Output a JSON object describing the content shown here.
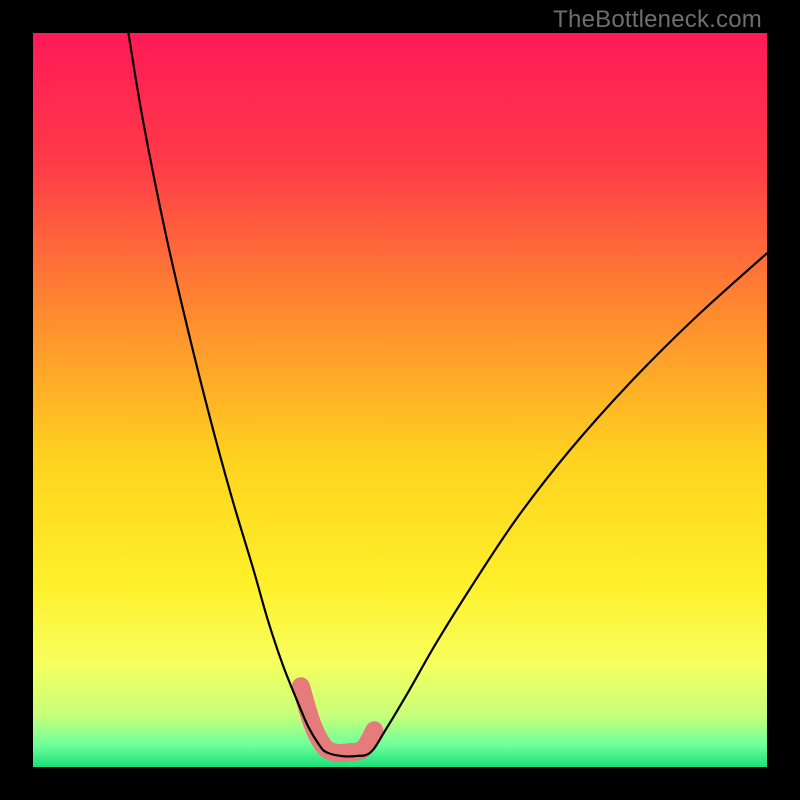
{
  "watermark": "TheBottleneck.com",
  "chart_data": {
    "type": "line",
    "title": "",
    "xlabel": "",
    "ylabel": "",
    "x_range": [
      0,
      100
    ],
    "y_range": [
      0,
      100
    ],
    "series": [
      {
        "name": "left-curve",
        "x": [
          13.0,
          15.0,
          18.0,
          21.0,
          24.0,
          27.0,
          30.0,
          32.0,
          34.0,
          36.0,
          37.5,
          39.0,
          40.0
        ],
        "y": [
          100.0,
          88.0,
          73.0,
          60.0,
          48.0,
          37.0,
          27.0,
          20.0,
          14.0,
          9.0,
          5.5,
          3.0,
          2.0
        ]
      },
      {
        "name": "valley-flat",
        "x": [
          40.0,
          42.0,
          44.0,
          46.0
        ],
        "y": [
          2.0,
          1.5,
          1.5,
          2.0
        ]
      },
      {
        "name": "right-curve",
        "x": [
          46.0,
          48.0,
          51.0,
          55.0,
          60.0,
          66.0,
          73.0,
          81.0,
          90.0,
          100.0
        ],
        "y": [
          2.0,
          5.0,
          10.0,
          17.0,
          25.0,
          34.0,
          43.0,
          52.0,
          61.0,
          70.0
        ]
      },
      {
        "name": "highlight-segment",
        "x": [
          36.5,
          38.0,
          39.5,
          41.0,
          43.0,
          45.0,
          46.5
        ],
        "y": [
          11.0,
          6.0,
          3.0,
          2.0,
          2.0,
          2.5,
          5.0
        ]
      }
    ],
    "gradient_stops": [
      {
        "pct": 0,
        "color": "#ff1a57"
      },
      {
        "pct": 18,
        "color": "#ff3b48"
      },
      {
        "pct": 38,
        "color": "#ff8a2f"
      },
      {
        "pct": 58,
        "color": "#ffd21f"
      },
      {
        "pct": 75,
        "color": "#fff02a"
      },
      {
        "pct": 86,
        "color": "#f6ff5e"
      },
      {
        "pct": 93,
        "color": "#c6ff7a"
      },
      {
        "pct": 97,
        "color": "#6fff9a"
      },
      {
        "pct": 100,
        "color": "#19e07a"
      }
    ],
    "highlight_color": "#e57b7b",
    "curve_color": "#000000"
  }
}
